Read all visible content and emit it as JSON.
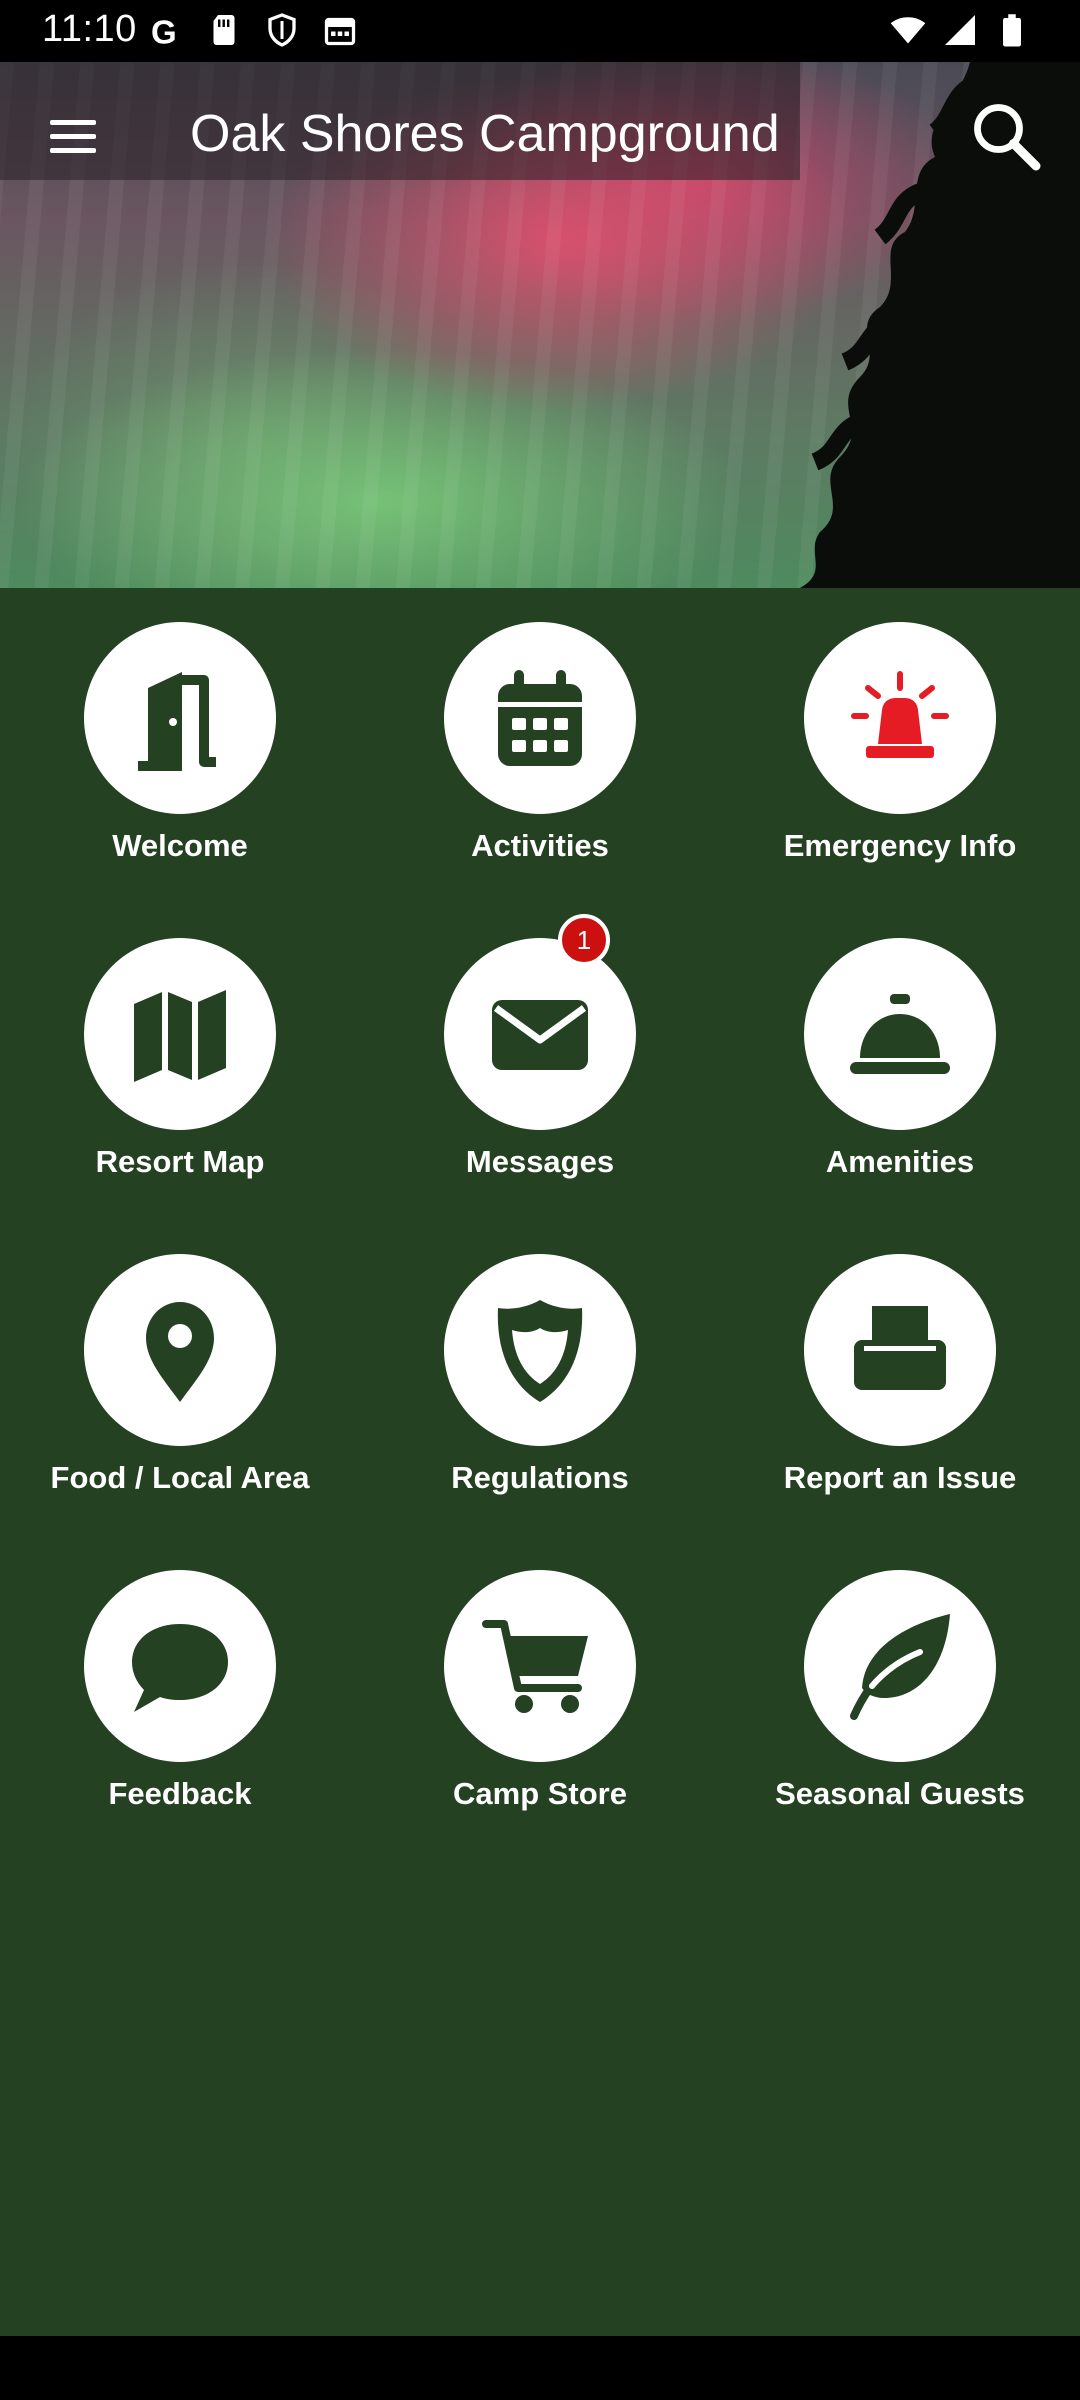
{
  "status_bar": {
    "time": "11:10",
    "left_icons": [
      "google-icon",
      "sim-card-icon",
      "shield-icon",
      "calendar-icon"
    ],
    "right_icons": [
      "wifi-icon",
      "signal-icon",
      "battery-icon"
    ]
  },
  "app_bar": {
    "title": "Oak Shores Campground",
    "menu_icon": "menu-icon",
    "search_icon": "search-icon"
  },
  "colors": {
    "background": "#244122",
    "tile": "#ffffff",
    "icon": "#244122",
    "emergency_icon": "#e51c23",
    "badge": "#cc0f0f"
  },
  "tiles": [
    {
      "label": "Welcome",
      "icon": "door-icon"
    },
    {
      "label": "Activities",
      "icon": "calendar-icon"
    },
    {
      "label": "Emergency Info",
      "icon": "siren-icon"
    },
    {
      "label": "Resort Map",
      "icon": "map-icon"
    },
    {
      "label": "Messages",
      "icon": "envelope-icon",
      "badge": "1"
    },
    {
      "label": "Amenities",
      "icon": "service-bell-icon"
    },
    {
      "label": "Food / Local Area",
      "icon": "map-pin-icon"
    },
    {
      "label": "Regulations",
      "icon": "shield-icon"
    },
    {
      "label": "Report an Issue",
      "icon": "printer-icon"
    },
    {
      "label": "Feedback",
      "icon": "speech-bubble-icon"
    },
    {
      "label": "Camp Store",
      "icon": "shopping-cart-icon"
    },
    {
      "label": "Seasonal Guests",
      "icon": "leaf-icon"
    }
  ]
}
